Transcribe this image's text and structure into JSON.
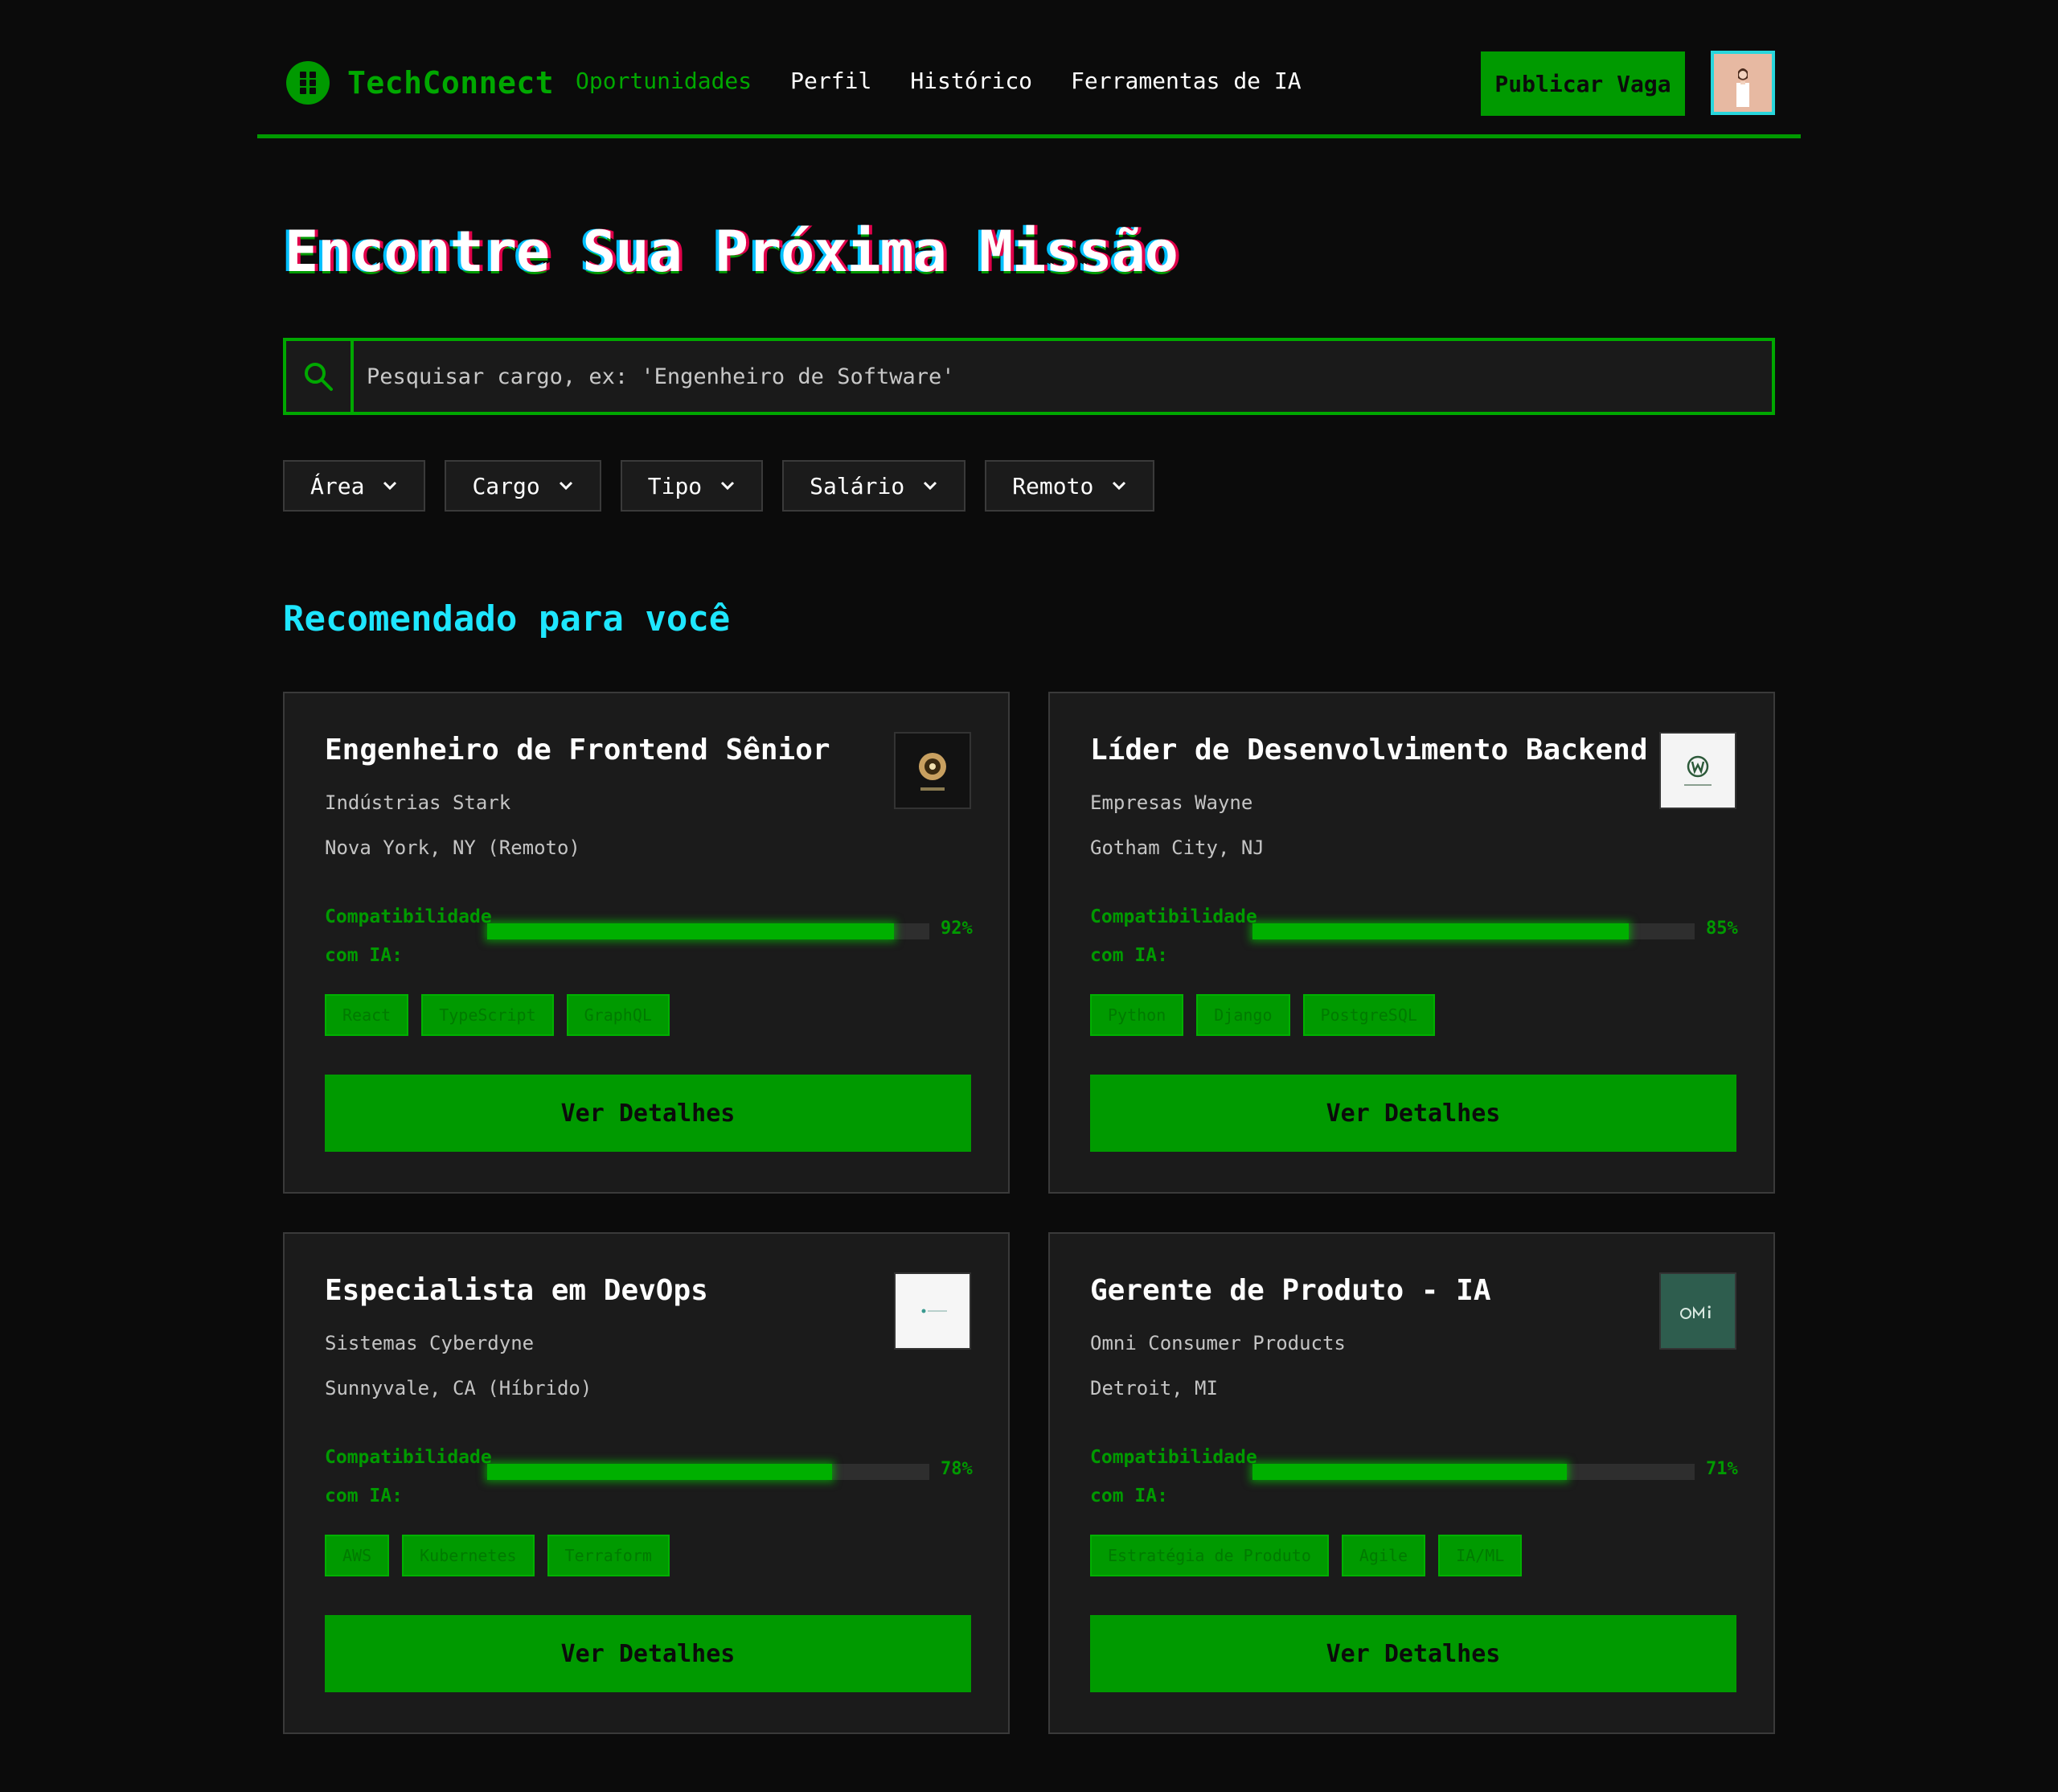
{
  "brand": {
    "name": "TechConnect",
    "accent": "#009a00",
    "highlight": "#1ee6ff"
  },
  "nav": {
    "items": [
      {
        "label": "Oportunidades",
        "active": true
      },
      {
        "label": "Perfil",
        "active": false
      },
      {
        "label": "Histórico",
        "active": false
      },
      {
        "label": "Ferramentas de IA",
        "active": false
      }
    ],
    "post_label": "Publicar Vaga",
    "avatar_icon": "user-avatar"
  },
  "hero": {
    "title": "Encontre Sua Próxima Missão"
  },
  "search": {
    "placeholder": "Pesquisar cargo, ex: 'Engenheiro de Software'",
    "value": ""
  },
  "filters": [
    {
      "label": "Área"
    },
    {
      "label": "Cargo"
    },
    {
      "label": "Tipo"
    },
    {
      "label": "Salário"
    },
    {
      "label": "Remoto"
    }
  ],
  "section": {
    "title": "Recomendado para você"
  },
  "jobs": [
    {
      "title": "Engenheiro de Frontend Sênior",
      "company": "Indústrias Stark",
      "location": "Nova York, NY (Remoto)",
      "logo_icon": "stark-logo",
      "match_label": "Compatibilidade com IA:",
      "match_value": "92%",
      "match_fraction": 0.92,
      "tags": [
        "React",
        "TypeScript",
        "GraphQL"
      ],
      "button_label": "Ver Detalhes"
    },
    {
      "title": "Líder de Desenvolvimento Backend",
      "company": "Empresas Wayne",
      "location": "Gotham City, NJ",
      "logo_icon": "wayne-logo",
      "match_label": "Compatibilidade com IA:",
      "match_value": "85%",
      "match_fraction": 0.85,
      "tags": [
        "Python",
        "Django",
        "PostgreSQL"
      ],
      "button_label": "Ver Detalhes"
    },
    {
      "title": "Especialista em DevOps",
      "company": "Sistemas Cyberdyne",
      "location": "Sunnyvale, CA (Híbrido)",
      "logo_icon": "cyberdyne-logo",
      "match_label": "Compatibilidade com IA:",
      "match_value": "78%",
      "match_fraction": 0.78,
      "tags": [
        "AWS",
        "Kubernetes",
        "Terraform"
      ],
      "button_label": "Ver Detalhes"
    },
    {
      "title": "Gerente de Produto - IA",
      "company": "Omni Consumer Products",
      "location": "Detroit, MI",
      "logo_icon": "omni-logo",
      "match_label": "Compatibilidade com IA:",
      "match_value": "71%",
      "match_fraction": 0.71,
      "tags": [
        "Estratégia de Produto",
        "Agile",
        "IA/ML"
      ],
      "button_label": "Ver Detalhes"
    }
  ]
}
